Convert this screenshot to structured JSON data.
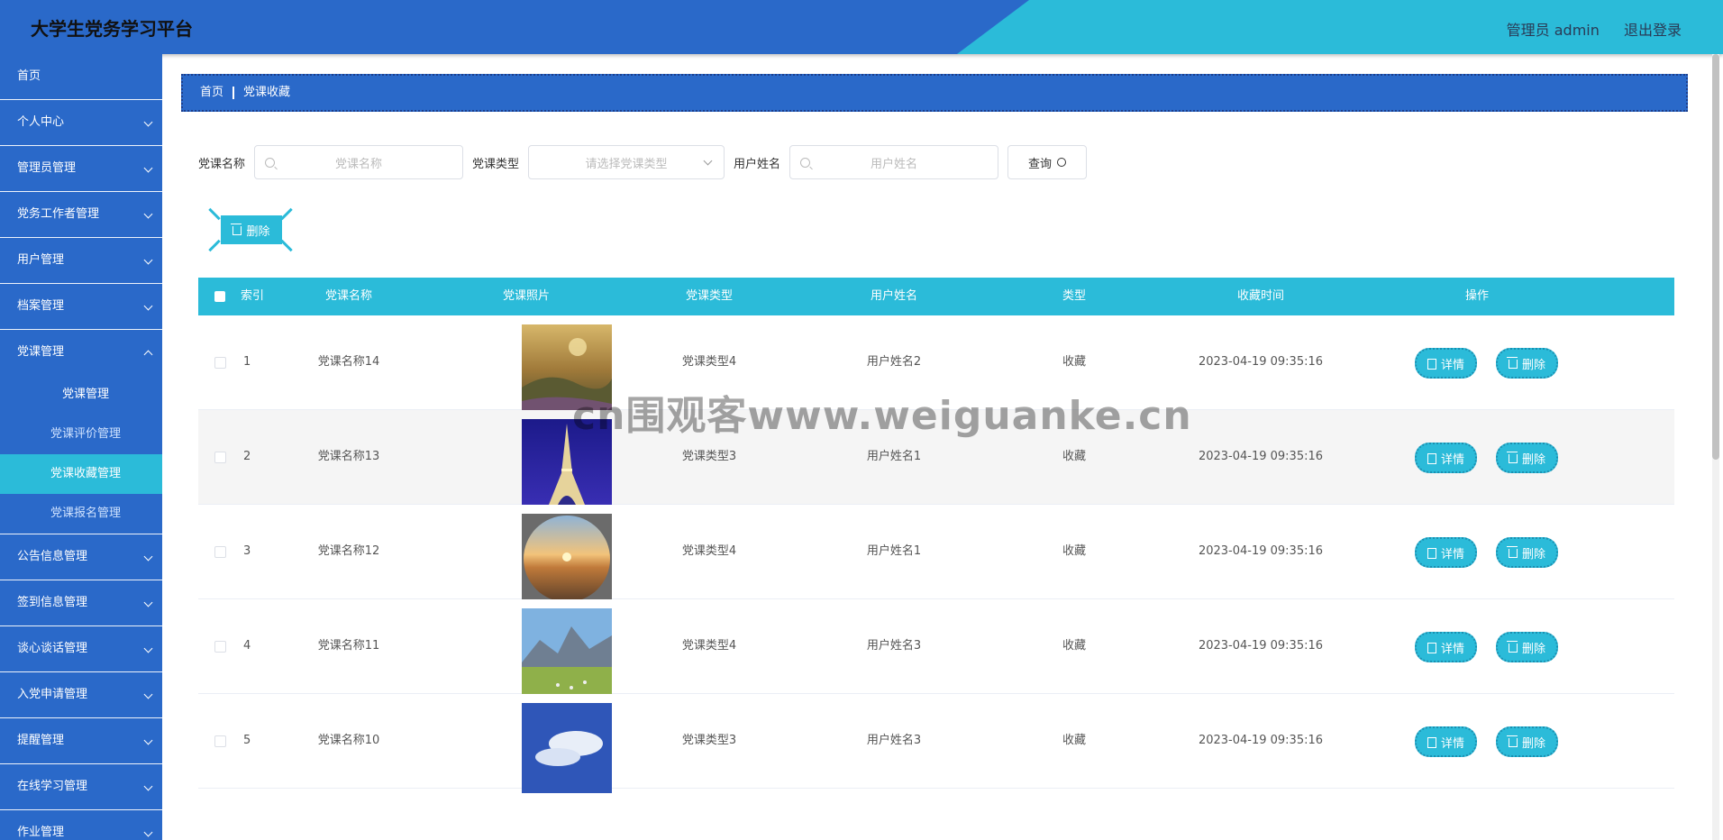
{
  "header": {
    "title": "大学生党务学习平台",
    "user": "管理员 admin",
    "logout": "退出登录"
  },
  "sidebar": {
    "items": [
      {
        "label": "首页"
      },
      {
        "label": "个人中心"
      },
      {
        "label": "管理员管理"
      },
      {
        "label": "党务工作者管理"
      },
      {
        "label": "用户管理"
      },
      {
        "label": "档案管理"
      },
      {
        "label": "党课管理"
      }
    ],
    "sub_items": [
      {
        "label": "党课管理"
      },
      {
        "label": "党课评价管理"
      },
      {
        "label": "党课收藏管理"
      },
      {
        "label": "党课报名管理"
      }
    ],
    "items_after": [
      {
        "label": "公告信息管理"
      },
      {
        "label": "签到信息管理"
      },
      {
        "label": "谈心谈话管理"
      },
      {
        "label": "入党申请管理"
      },
      {
        "label": "提醒管理"
      },
      {
        "label": "在线学习管理"
      },
      {
        "label": "作业管理"
      }
    ]
  },
  "breadcrumb": {
    "home": "首页",
    "current": "党课收藏"
  },
  "search": {
    "name_label": "党课名称",
    "name_placeholder": "党课名称",
    "type_label": "党课类型",
    "type_placeholder": "请选择党课类型",
    "user_label": "用户姓名",
    "user_placeholder": "用户姓名",
    "query": "查询"
  },
  "toolbar": {
    "delete": "删除"
  },
  "table": {
    "headers": [
      "索引",
      "党课名称",
      "党课照片",
      "党课类型",
      "用户姓名",
      "类型",
      "收藏时间",
      "操作"
    ],
    "detail": "详情",
    "delete": "删除",
    "rows": [
      {
        "index": "1",
        "name": "党课名称14",
        "type": "党课类型4",
        "user": "用户姓名2",
        "kind": "收藏",
        "time": "2023-04-19 09:35:16"
      },
      {
        "index": "2",
        "name": "党课名称13",
        "type": "党课类型3",
        "user": "用户姓名1",
        "kind": "收藏",
        "time": "2023-04-19 09:35:16"
      },
      {
        "index": "3",
        "name": "党课名称12",
        "type": "党课类型4",
        "user": "用户姓名1",
        "kind": "收藏",
        "time": "2023-04-19 09:35:16"
      },
      {
        "index": "4",
        "name": "党课名称11",
        "type": "党课类型4",
        "user": "用户姓名3",
        "kind": "收藏",
        "time": "2023-04-19 09:35:16"
      },
      {
        "index": "5",
        "name": "党课名称10",
        "type": "党课类型3",
        "user": "用户姓名3",
        "kind": "收藏",
        "time": "2023-04-19 09:35:16"
      }
    ]
  },
  "watermark": "cn围观客www.weiguanke.cn",
  "colors": {
    "primary": "#2a69c9",
    "accent": "#2bbbd9"
  }
}
